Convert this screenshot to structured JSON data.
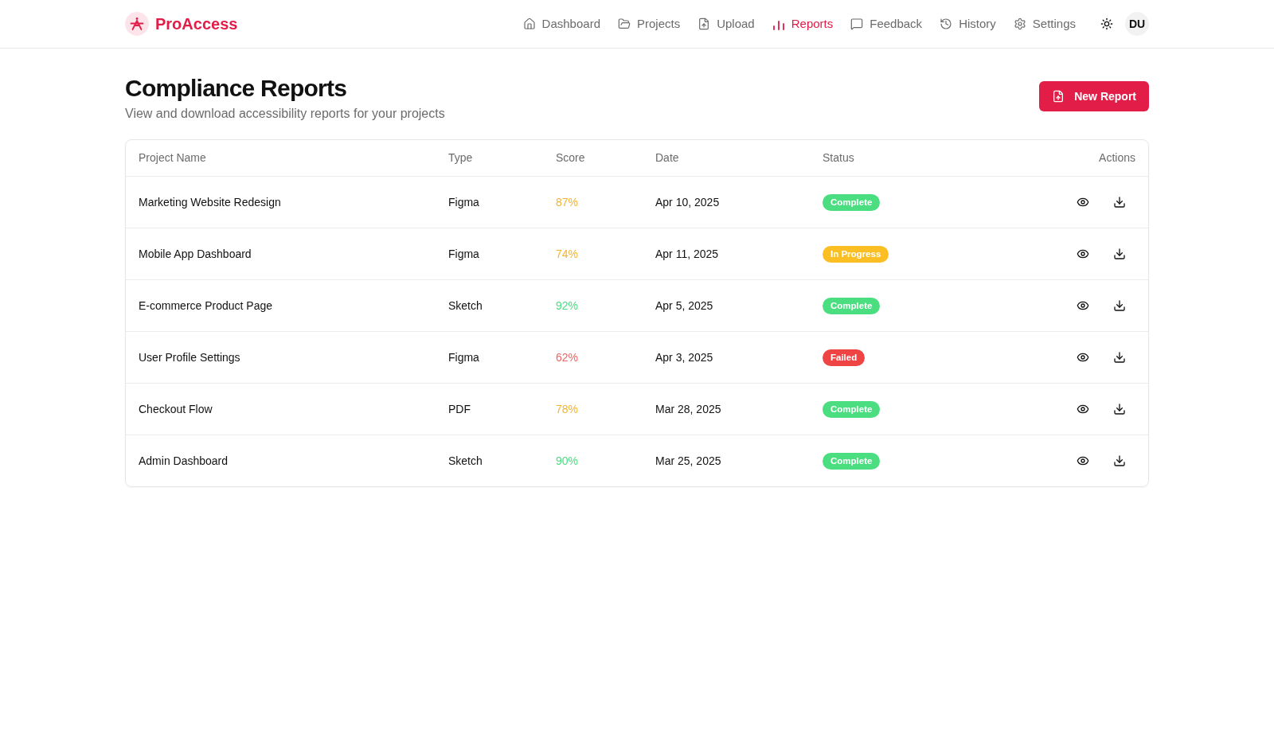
{
  "header": {
    "brand": "ProAccess",
    "nav": [
      {
        "label": "Dashboard",
        "selected": false
      },
      {
        "label": "Projects",
        "selected": false
      },
      {
        "label": "Upload",
        "selected": false
      },
      {
        "label": "Reports",
        "selected": true
      },
      {
        "label": "Feedback",
        "selected": false
      },
      {
        "label": "History",
        "selected": false
      },
      {
        "label": "Settings",
        "selected": false
      }
    ],
    "avatar": "DU"
  },
  "page": {
    "title": "Compliance Reports",
    "subtitle": "View and download accessibility reports for your projects",
    "new_button": "New Report"
  },
  "table": {
    "columns": [
      "Project Name",
      "Type",
      "Score",
      "Date",
      "Status",
      "Actions"
    ],
    "rows": [
      {
        "project": "Marketing Website Redesign",
        "type": "Figma",
        "score": {
          "text": "87%",
          "color": "#f2b52f"
        },
        "date": "Apr 10, 2025",
        "status": {
          "label": "Complete",
          "color": "#4ade80"
        }
      },
      {
        "project": "Mobile App Dashboard",
        "type": "Figma",
        "score": {
          "text": "74%",
          "color": "#f2b52f"
        },
        "date": "Apr 11, 2025",
        "status": {
          "label": "In Progress",
          "color": "#fbbf24"
        }
      },
      {
        "project": "E-commerce Product Page",
        "type": "Sketch",
        "score": {
          "text": "92%",
          "color": "#4ade80"
        },
        "date": "Apr 5, 2025",
        "status": {
          "label": "Complete",
          "color": "#4ade80"
        }
      },
      {
        "project": "User Profile Settings",
        "type": "Figma",
        "score": {
          "text": "62%",
          "color": "#f06565"
        },
        "date": "Apr 3, 2025",
        "status": {
          "label": "Failed",
          "color": "#ef4444"
        }
      },
      {
        "project": "Checkout Flow",
        "type": "PDF",
        "score": {
          "text": "78%",
          "color": "#f2b52f"
        },
        "date": "Mar 28, 2025",
        "status": {
          "label": "Complete",
          "color": "#4ade80"
        }
      },
      {
        "project": "Admin Dashboard",
        "type": "Sketch",
        "score": {
          "text": "90%",
          "color": "#4ade80"
        },
        "date": "Mar 25, 2025",
        "status": {
          "label": "Complete",
          "color": "#4ade80"
        }
      }
    ]
  }
}
